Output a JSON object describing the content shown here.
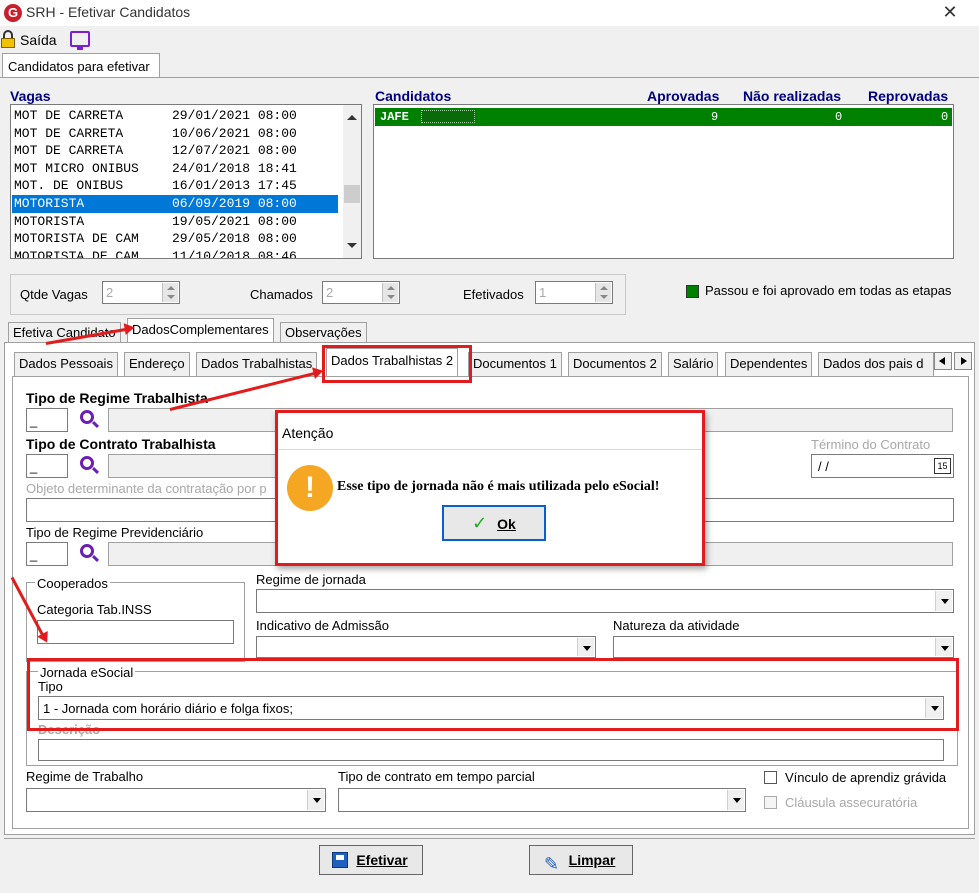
{
  "window": {
    "title": "SRH - Efetivar Candidatos"
  },
  "toolbar": {
    "exit_label": "Saída"
  },
  "main_tab": "Candidatos para efetivar",
  "vagas": {
    "header": "Vagas",
    "rows": [
      {
        "name": "MOT DE CARRETA",
        "date": "29/01/2021 08:00"
      },
      {
        "name": "MOT DE CARRETA",
        "date": "10/06/2021 08:00"
      },
      {
        "name": "MOT DE CARRETA",
        "date": "12/07/2021 08:00"
      },
      {
        "name": "MOT MICRO ONIBUS",
        "date": "24/01/2018 18:41"
      },
      {
        "name": "MOT. DE ONIBUS",
        "date": "16/01/2013 17:45"
      },
      {
        "name": "MOTORISTA",
        "date": "06/09/2019 08:00"
      },
      {
        "name": "MOTORISTA",
        "date": "19/05/2021 08:00"
      },
      {
        "name": "MOTORISTA DE CAM",
        "date": "29/05/2018 08:00"
      },
      {
        "name": "MOTORISTA DE CAM",
        "date": "11/10/2018 08:46"
      }
    ],
    "selected_index": 5
  },
  "candidatos": {
    "headers": [
      "Candidatos",
      "Aprovadas",
      "Não realizadas",
      "Reprovadas"
    ],
    "rows": [
      {
        "name": "JAFE",
        "aprovadas": "9",
        "nao_realizadas": "0",
        "reprovadas": "0"
      }
    ]
  },
  "counts": {
    "qtde_vagas_label": "Qtde Vagas",
    "qtde_vagas": "2",
    "chamados_label": "Chamados",
    "chamados": "2",
    "efetivados_label": "Efetivados",
    "efetivados": "1"
  },
  "legend": {
    "text": "Passou e foi aprovado em todas as etapas",
    "color": "#008000"
  },
  "tabs": [
    "Efetiva Candidato",
    "DadosComplementares",
    "Observações"
  ],
  "subtabs": [
    "Dados Pessoais",
    "Endereço",
    "Dados Trabalhistas",
    "Dados Trabalhistas 2",
    "Documentos 1",
    "Documentos 2",
    "Salário",
    "Dependentes",
    "Dados dos pais d"
  ],
  "form": {
    "tipo_regime_trabalhista": "Tipo de Regime Trabalhista",
    "tipo_regime_value": "_",
    "tipo_contrato": "Tipo de Contrato Trabalhista",
    "tipo_contrato_value": "_",
    "termino_contrato": "Término do Contrato",
    "termino_value": " / /",
    "objeto": "Objeto determinante da contratação por p",
    "regime_previdenciario": "Tipo de Regime Previdenciário",
    "regime_previdenciario_value": "_",
    "cooperados": "Cooperados",
    "categoria": "Categoria Tab.INSS",
    "regime_jornada": "Regime de jornada",
    "indicativo_admissao": "Indicativo de Admissão",
    "natureza_atividade": "Natureza da atividade",
    "jornada_group": "Jornada eSocial",
    "tipo": "Tipo",
    "tipo_value": "1 - Jornada com horário diário e folga fixos;",
    "descricao": "Descrição",
    "regime_trabalho": "Regime de Trabalho",
    "contrato_parcial": "Tipo de contrato em tempo parcial",
    "vinculo": "Vínculo de aprendiz grávida",
    "clausula": "Cláusula assecuratória"
  },
  "dialog": {
    "title": "Atenção",
    "message": "Esse tipo de jornada não é mais utilizada pelo eSocial!",
    "ok": "Ok"
  },
  "buttons": {
    "efetivar": "Efetivar",
    "limpar": "Limpar"
  },
  "colors": {
    "selection": "#0078d7",
    "highlight": "#e21c1c",
    "approved_row": "#008000"
  }
}
